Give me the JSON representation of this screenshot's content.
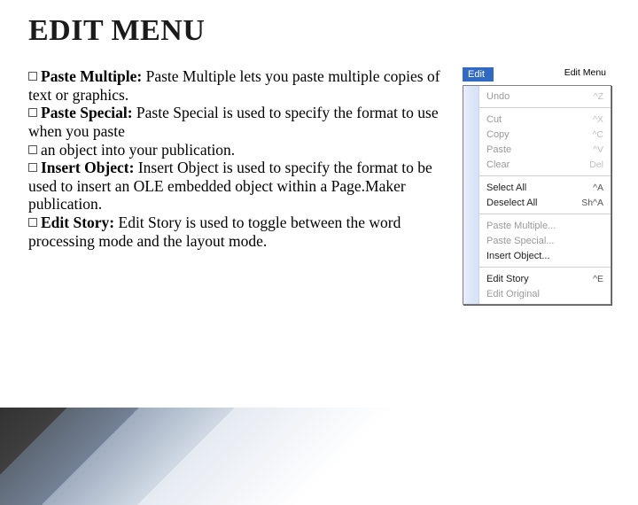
{
  "title": "EDIT MENU",
  "bullets": [
    {
      "bold": "Paste Multiple:",
      "text": " Paste Multiple lets you paste multiple copies of text or graphics."
    },
    {
      "bold": "Paste Special:",
      "text": " Paste Special is used to specify the format to use when you paste"
    },
    {
      "bold": "",
      "text": "an object into your publication."
    },
    {
      "bold": "Insert Object:",
      "text": " Insert Object is used to specify the format to be used to insert an OLE embedded object within a Page.Maker publication."
    },
    {
      "bold": "Edit Story:",
      "text": " Edit Story is used to toggle between the word processing mode and the layout mode."
    }
  ],
  "menu": {
    "tab": "Edit",
    "caption": "Edit Menu",
    "groups": [
      [
        {
          "label": "Undo",
          "shortcut": "^Z",
          "dim": true
        }
      ],
      [
        {
          "label": "Cut",
          "shortcut": "^X",
          "dim": true
        },
        {
          "label": "Copy",
          "shortcut": "^C",
          "dim": true
        },
        {
          "label": "Paste",
          "shortcut": "^V",
          "dim": true
        },
        {
          "label": "Clear",
          "shortcut": "Del",
          "dim": true
        }
      ],
      [
        {
          "label": "Select All",
          "shortcut": "^A",
          "dim": false
        },
        {
          "label": "Deselect All",
          "shortcut": "Sh^A",
          "dim": false
        }
      ],
      [
        {
          "label": "Paste Multiple...",
          "shortcut": "",
          "dim": true
        },
        {
          "label": "Paste Special...",
          "shortcut": "",
          "dim": true
        },
        {
          "label": "Insert Object...",
          "shortcut": "",
          "dim": false
        }
      ],
      [
        {
          "label": "Edit Story",
          "shortcut": "^E",
          "dim": false
        },
        {
          "label": "Edit Original",
          "shortcut": "",
          "dim": true
        }
      ]
    ]
  }
}
